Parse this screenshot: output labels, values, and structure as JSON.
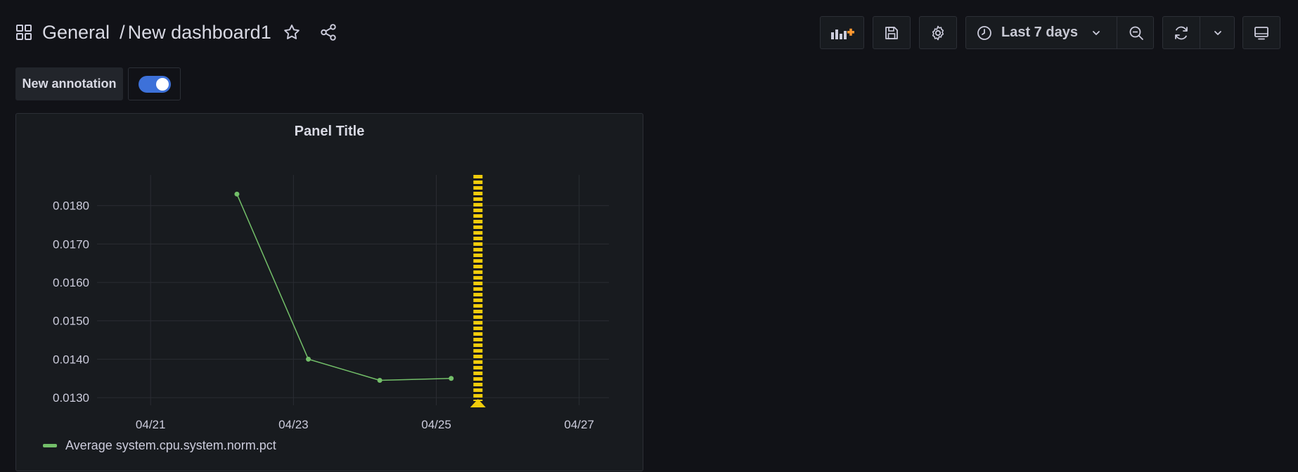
{
  "breadcrumb": {
    "folder": "General",
    "separator": "/",
    "dashboard": "New dashboard1"
  },
  "toolbar": {
    "time_range": "Last 7 days"
  },
  "annotation": {
    "label": "New annotation",
    "enabled": true
  },
  "panel": {
    "title": "Panel Title"
  },
  "colors": {
    "background": "#111217",
    "panel": "#181b1f",
    "series": "#73bf69",
    "annotation": "#f2cc0c",
    "toggle": "#3d71d9",
    "add_panel_plus": "#ff9830"
  },
  "icons": {
    "grid": "apps-icon",
    "star": "star-icon",
    "share": "share-icon",
    "add_panel": "add-panel-icon",
    "save": "save-icon",
    "settings": "gear-icon",
    "clock": "clock-icon",
    "chevron": "chevron-down-icon",
    "zoom_out": "zoom-out-icon",
    "refresh": "refresh-icon",
    "tv": "tv-mode-icon"
  },
  "chart_data": {
    "type": "line",
    "title": "Panel Title",
    "series": [
      {
        "name": "Average system.cpu.system.norm.pct",
        "x": [
          "04/22 05:00",
          "04/23 05:00",
          "04/24 05:00",
          "04/25 05:00"
        ],
        "y": [
          0.0183,
          0.014,
          0.01345,
          0.0135
        ]
      }
    ],
    "x_ticks": [
      "04/21",
      "04/23",
      "04/25",
      "04/27"
    ],
    "x_range": [
      "04/20 06:00",
      "04/27 10:00"
    ],
    "y_ticks": [
      "0.0130",
      "0.0140",
      "0.0150",
      "0.0160",
      "0.0170",
      "0.0180"
    ],
    "ylim": [
      0.0128,
      0.0188
    ],
    "annotations": [
      {
        "x": "04/25 14:00",
        "type": "region"
      }
    ],
    "grid": true,
    "legend": "bottom-left"
  }
}
